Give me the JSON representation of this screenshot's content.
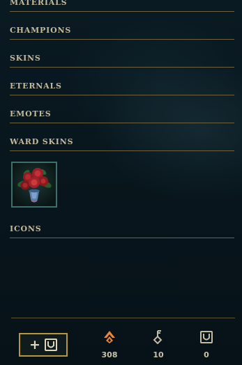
{
  "sections": [
    {
      "id": "materials",
      "label": "MATERIALS"
    },
    {
      "id": "champions",
      "label": "CHAMPIONS"
    },
    {
      "id": "skins",
      "label": "SKINS"
    },
    {
      "id": "eternals",
      "label": "ETERNALS"
    },
    {
      "id": "emotes",
      "label": "EMOTES"
    },
    {
      "id": "ward-skins",
      "label": "WARD SKINS"
    },
    {
      "id": "icons",
      "label": "ICONS"
    }
  ],
  "ward_skins": [
    {
      "icon": "rose-bouquet-ward-icon"
    }
  ],
  "footer": {
    "craft_button_icon": "plus-chest-icon",
    "currencies": [
      {
        "id": "orange-essence",
        "icon": "orange-essence-icon",
        "value": "308",
        "color": "#e8873a"
      },
      {
        "id": "key-fragments",
        "icon": "key-fragment-icon",
        "value": "10",
        "color": "#c2bba6"
      },
      {
        "id": "chests",
        "icon": "chest-icon",
        "value": "0",
        "color": "#c2bba6"
      }
    ]
  },
  "colors": {
    "section_divider": "#6f6240",
    "section_title": "#c3b99d",
    "button_border": "#b8963e",
    "background": "#08161d"
  }
}
